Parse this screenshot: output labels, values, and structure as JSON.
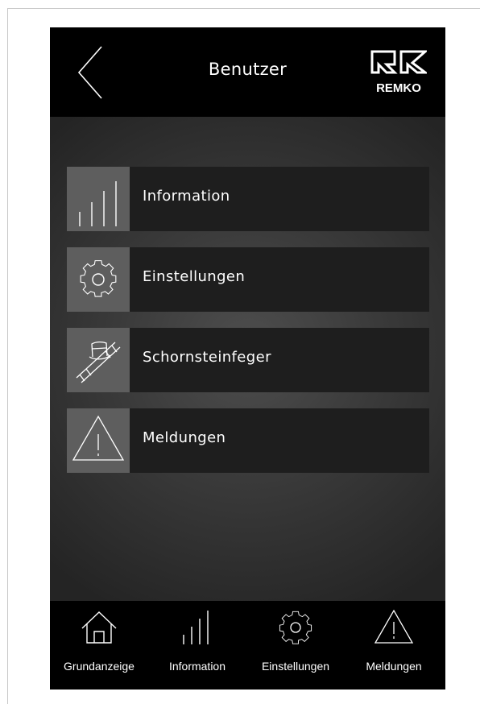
{
  "header": {
    "title": "Benutzer",
    "back_icon": "chevron-left-icon",
    "logo_text": "REMKO"
  },
  "menu": {
    "items": [
      {
        "label": "Information",
        "icon": "bar-chart-icon"
      },
      {
        "label": "Einstellungen",
        "icon": "gear-icon"
      },
      {
        "label": "Schornsteinfeger",
        "icon": "chimney-sweep-icon"
      },
      {
        "label": "Meldungen",
        "icon": "warning-icon"
      }
    ]
  },
  "bottom_nav": {
    "items": [
      {
        "label": "Grundanzeige",
        "icon": "home-icon"
      },
      {
        "label": "Information",
        "icon": "bar-chart-icon"
      },
      {
        "label": "Einstellungen",
        "icon": "gear-icon"
      },
      {
        "label": "Meldungen",
        "icon": "warning-icon"
      }
    ]
  },
  "colors": {
    "header_bg": "#000000",
    "tile_bg": "#1e1e1e",
    "icon_tile_bg": "#5e5e5e",
    "text": "#ffffff"
  }
}
